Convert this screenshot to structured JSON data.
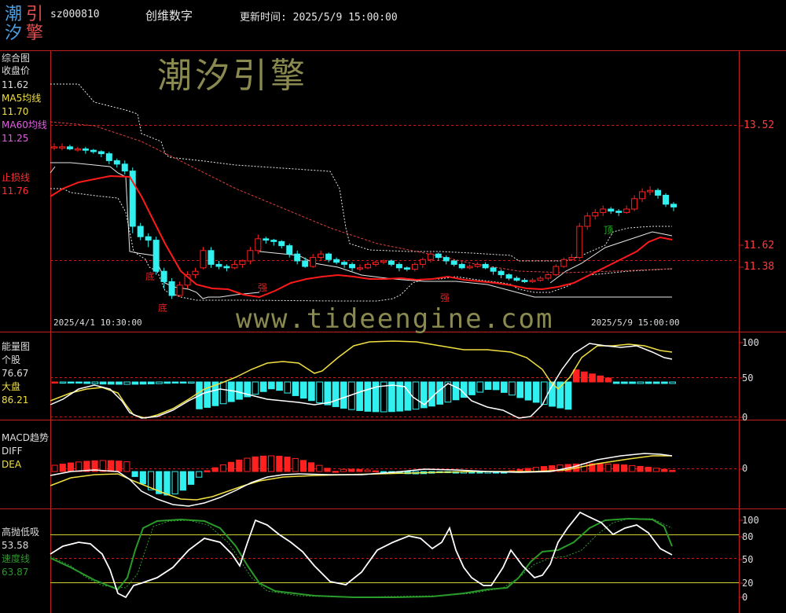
{
  "header": {
    "logo_chars": [
      "潮",
      "引",
      "汐",
      "擎"
    ],
    "stock_code": "sz000810",
    "stock_name": "创维数字",
    "update_time": "更新时间: 2025/5/9 15:00:00"
  },
  "watermarks": [
    "潮汐引擎",
    "www.tideengine.com"
  ],
  "panel_main": {
    "title": "综合图",
    "close_label": "收盘价",
    "close_value": "11.62",
    "ma5_label": "MA5均线",
    "ma5_value": "11.70",
    "ma60_label": "MA60均线",
    "ma60_value": "11.25",
    "stop_label": "止损线",
    "stop_value": "11.76",
    "axis_labels": [
      "13.52",
      "11.62",
      "11.38"
    ],
    "annotations": [
      "底",
      "底",
      "强",
      "强",
      "顶"
    ],
    "date_start": "2025/4/1 10:30:00",
    "date_end": "2025/5/9 15:00:00",
    "colors": {
      "up": "#ff2020",
      "down": "#30f0f0",
      "ma": "#ff2020",
      "band": "#ffffff",
      "grid": "#c02020"
    }
  },
  "panel_energy": {
    "title": "能量图",
    "stock_label": "个股",
    "stock_value": "76.67",
    "market_label": "大盘",
    "market_value": "86.21",
    "axis_labels": [
      "100",
      "50",
      "0"
    ]
  },
  "panel_macd": {
    "title": "MACD趋势",
    "diff_label": "DIFF",
    "dea_label": "DEA",
    "axis_labels": [
      "0"
    ]
  },
  "panel_tide": {
    "title": "高抛低吸",
    "value1": "53.58",
    "speed_label": "速度线",
    "speed_value": "63.87",
    "axis_labels": [
      "100",
      "80",
      "50",
      "20",
      "0"
    ]
  },
  "chart_data": [
    {
      "type": "candlestick",
      "x_range": [
        "2025/4/1 10:30:00",
        "2025/5/9 15:00:00"
      ],
      "ylim": [
        10.4,
        14.4
      ],
      "reference_lines": [
        13.52,
        11.62,
        11.38
      ],
      "candles": [
        [
          13.05,
          13.05,
          13.1,
          13.0
        ],
        [
          13.05,
          13.05,
          13.1,
          13.0
        ],
        [
          13.05,
          13.02,
          13.08,
          13.0
        ],
        [
          13.02,
          13.02,
          13.05,
          12.98
        ],
        [
          13.02,
          13.0,
          13.05,
          12.95
        ],
        [
          13.0,
          12.98,
          13.02,
          12.95
        ],
        [
          12.98,
          12.95,
          13.0,
          12.9
        ],
        [
          12.95,
          12.85,
          12.98,
          12.8
        ],
        [
          12.85,
          12.8,
          12.88,
          12.75
        ],
        [
          12.8,
          12.7,
          12.85,
          12.65
        ],
        [
          12.7,
          11.9,
          12.75,
          11.8
        ],
        [
          11.9,
          11.75,
          11.95,
          11.7
        ],
        [
          11.75,
          11.7,
          11.8,
          11.6
        ],
        [
          11.7,
          11.25,
          11.75,
          11.2
        ],
        [
          11.25,
          11.1,
          11.3,
          11.0
        ],
        [
          11.1,
          10.9,
          11.15,
          10.85
        ],
        [
          10.9,
          11.05,
          11.1,
          10.88
        ],
        [
          11.05,
          11.2,
          11.25,
          11.0
        ],
        [
          11.2,
          11.25,
          11.3,
          11.15
        ],
        [
          11.3,
          11.55,
          11.6,
          11.28
        ],
        [
          11.55,
          11.35,
          11.6,
          11.3
        ],
        [
          11.35,
          11.32,
          11.4,
          11.28
        ],
        [
          11.32,
          11.3,
          11.35,
          11.25
        ],
        [
          11.3,
          11.35,
          11.4,
          11.28
        ],
        [
          11.35,
          11.4,
          11.42,
          11.3
        ],
        [
          11.4,
          11.55,
          11.6,
          11.35
        ],
        [
          11.55,
          11.72,
          11.78,
          11.5
        ],
        [
          11.72,
          11.7,
          11.75,
          11.65
        ],
        [
          11.7,
          11.68,
          11.72,
          11.62
        ],
        [
          11.68,
          11.62,
          11.7,
          11.58
        ],
        [
          11.62,
          11.5,
          11.65,
          11.45
        ],
        [
          11.5,
          11.4,
          11.55,
          11.35
        ],
        [
          11.4,
          11.32,
          11.45,
          11.3
        ],
        [
          11.32,
          11.45,
          11.5,
          11.3
        ],
        [
          11.45,
          11.5,
          11.55,
          11.4
        ],
        [
          11.5,
          11.42,
          11.52,
          11.38
        ],
        [
          11.42,
          11.38,
          11.45,
          11.35
        ],
        [
          11.38,
          11.35,
          11.4,
          11.3
        ],
        [
          11.35,
          11.3,
          11.38,
          11.25
        ],
        [
          11.3,
          11.3,
          11.35,
          11.25
        ],
        [
          11.3,
          11.35,
          11.38,
          11.28
        ],
        [
          11.35,
          11.38,
          11.4,
          11.32
        ],
        [
          11.38,
          11.4,
          11.42,
          11.35
        ],
        [
          11.4,
          11.35,
          11.42,
          11.32
        ],
        [
          11.35,
          11.3,
          11.38,
          11.25
        ],
        [
          11.3,
          11.28,
          11.32,
          11.25
        ],
        [
          11.28,
          11.35,
          11.38,
          11.25
        ],
        [
          11.35,
          11.42,
          11.45,
          11.3
        ],
        [
          11.42,
          11.5,
          11.55,
          11.38
        ],
        [
          11.5,
          11.45,
          11.52,
          11.4
        ],
        [
          11.45,
          11.4,
          11.48,
          11.35
        ],
        [
          11.4,
          11.35,
          11.42,
          11.32
        ],
        [
          11.35,
          11.3,
          11.38,
          11.28
        ],
        [
          11.3,
          11.32,
          11.35,
          11.28
        ],
        [
          11.32,
          11.35,
          11.38,
          11.3
        ],
        [
          11.35,
          11.3,
          11.38,
          11.28
        ],
        [
          11.3,
          11.25,
          11.32,
          11.2
        ],
        [
          11.25,
          11.2,
          11.28,
          11.15
        ],
        [
          11.2,
          11.15,
          11.22,
          11.12
        ],
        [
          11.15,
          11.12,
          11.18,
          11.1
        ],
        [
          11.12,
          11.1,
          11.15,
          11.08
        ],
        [
          11.1,
          11.12,
          11.15,
          11.08
        ],
        [
          11.12,
          11.15,
          11.18,
          11.1
        ],
        [
          11.15,
          11.2,
          11.22,
          11.12
        ],
        [
          11.2,
          11.32,
          11.35,
          11.18
        ],
        [
          11.32,
          11.42,
          11.45,
          11.3
        ],
        [
          11.42,
          11.45,
          11.5,
          11.4
        ],
        [
          11.45,
          11.9,
          11.95,
          11.42
        ],
        [
          11.9,
          12.05,
          12.1,
          11.85
        ],
        [
          12.05,
          12.1,
          12.15,
          12.0
        ],
        [
          12.1,
          12.15,
          12.2,
          12.05
        ],
        [
          12.15,
          12.12,
          12.18,
          12.08
        ],
        [
          12.12,
          12.1,
          12.15,
          12.05
        ],
        [
          12.1,
          12.15,
          12.2,
          12.08
        ],
        [
          12.15,
          12.3,
          12.35,
          12.12
        ],
        [
          12.3,
          12.4,
          12.45,
          12.25
        ],
        [
          12.4,
          12.42,
          12.48,
          12.35
        ],
        [
          12.42,
          12.35,
          12.45,
          12.3
        ],
        [
          12.35,
          12.22,
          12.38,
          12.18
        ],
        [
          12.22,
          12.18,
          12.25,
          12.12
        ]
      ]
    }
  ]
}
